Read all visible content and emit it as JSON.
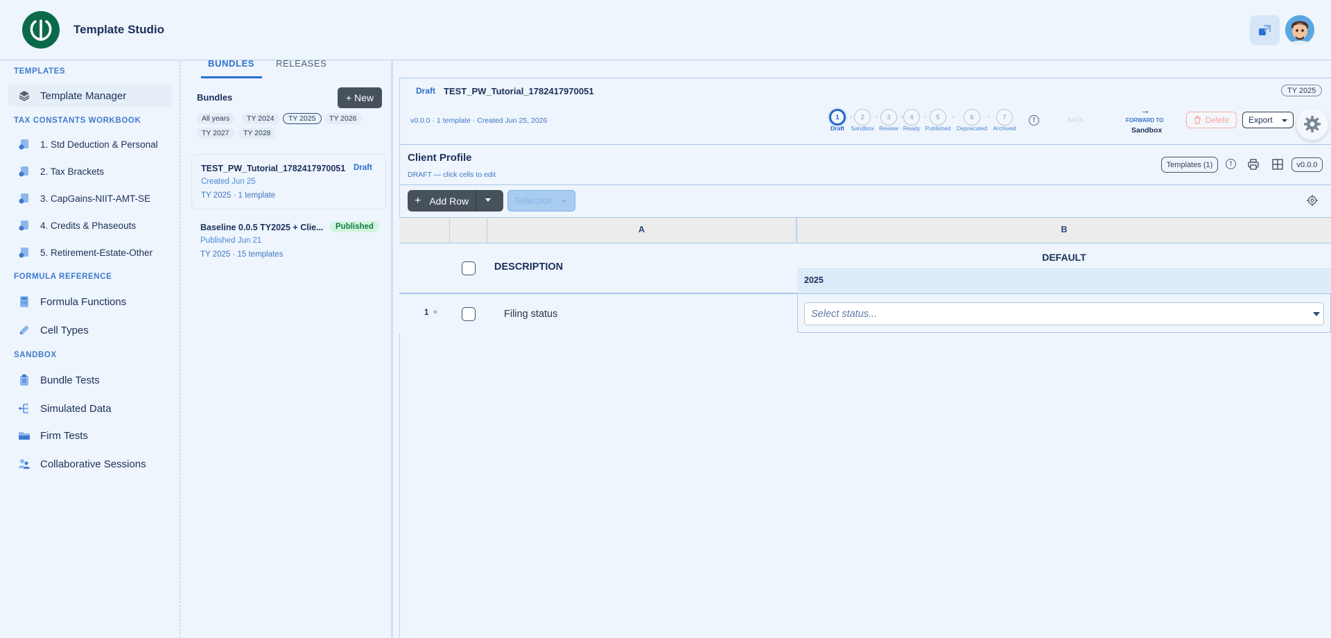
{
  "app": {
    "title": "Template Studio"
  },
  "sidebar": {
    "sections": [
      {
        "label": "TEMPLATES"
      },
      {
        "label": "TAX CONSTANTS WORKBOOK"
      },
      {
        "label": "FORMULA REFERENCE"
      },
      {
        "label": "SANDBOX"
      }
    ],
    "items": [
      {
        "label": "Template Manager",
        "icon": "layers-icon",
        "active": true
      },
      {
        "label": "1. Std Deduction & Personal",
        "icon": "workbook-icon"
      },
      {
        "label": "2. Tax Brackets",
        "icon": "workbook-icon"
      },
      {
        "label": "3. CapGains-NIIT-AMT-SE",
        "icon": "workbook-icon"
      },
      {
        "label": "4. Credits & Phaseouts",
        "icon": "workbook-icon"
      },
      {
        "label": "5. Retirement-Estate-Other",
        "icon": "workbook-icon"
      },
      {
        "label": "Formula Functions",
        "icon": "calculator-icon"
      },
      {
        "label": "Cell Types",
        "icon": "pen-icon"
      },
      {
        "label": "Bundle Tests",
        "icon": "clipboard-icon"
      },
      {
        "label": "Simulated Data",
        "icon": "tree-icon"
      },
      {
        "label": "Firm Tests",
        "icon": "folder-icon"
      },
      {
        "label": "Collaborative Sessions",
        "icon": "users-icon"
      }
    ]
  },
  "panel": {
    "tabs": [
      "BUNDLES",
      "RELEASES"
    ],
    "heading": "Bundles",
    "new_label": "+ New",
    "filters": [
      "All years",
      "TY 2024",
      "TY 2025",
      "TY 2026",
      "TY 2027",
      "TY 2028"
    ],
    "selected_filter": "TY 2025",
    "bundles": [
      {
        "title": "TEST_PW_Tutorial_1782417970051",
        "status": "Draft",
        "created": "Created Jun 25",
        "info": "TY 2025 · 1 template"
      },
      {
        "title": "Baseline 0.0.5 TY2025 + Clie...",
        "status": "Published",
        "created": "Published Jun 21",
        "info": "TY 2025 · 15 templates"
      }
    ]
  },
  "header": {
    "status": "Draft",
    "title": "TEST_PW_Tutorial_1782417970051",
    "ty_badge": "TY 2025",
    "meta": "v0.0.0 · 1 template · Created Jun 25, 2026",
    "steps": [
      {
        "num": "1",
        "label": "Draft"
      },
      {
        "num": "2",
        "label": "Sandbox"
      },
      {
        "num": "3",
        "label": "Review"
      },
      {
        "num": "4",
        "label": "Ready"
      },
      {
        "num": "5",
        "label": "Published"
      },
      {
        "num": "6",
        "label": "Deprecated"
      },
      {
        "num": "7",
        "label": "Archived"
      }
    ],
    "current_step": 1,
    "back_label": "BACK",
    "forward_label": "FORWARD TO",
    "forward_target": "Sandbox",
    "delete_label": "Delete",
    "export_label": "Export"
  },
  "editor": {
    "title": "Client Profile",
    "subtitle": "DRAFT — click cells to edit",
    "templates_label": "Templates (1)",
    "version_label": "v0.0.0",
    "add_row_label": "Add Row",
    "selection_label": "Selection"
  },
  "grid": {
    "col_a": "A",
    "col_b": "B",
    "desc_header": "DESCRIPTION",
    "default_header": "DEFAULT",
    "year": "2025",
    "rows": [
      {
        "num": "1",
        "description": "Filing status",
        "placeholder": "Select status..."
      }
    ]
  },
  "colors": {
    "accent": "#2a6fd0",
    "brand": "#0c6a4c",
    "published_bg": "#d2f5e0",
    "published_text": "#137a47",
    "dark_button": "#46515c"
  }
}
